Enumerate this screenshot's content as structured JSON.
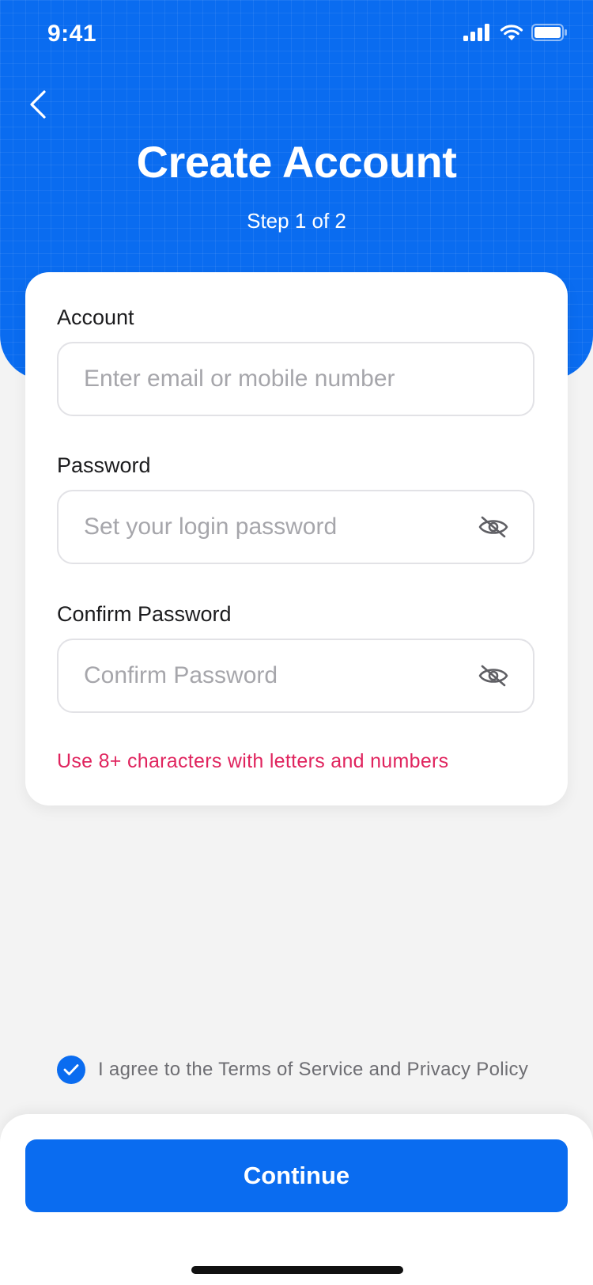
{
  "status_bar": {
    "time": "9:41"
  },
  "header": {
    "title": "Create Account",
    "step": "Step 1 of 2"
  },
  "form": {
    "account": {
      "label": "Account",
      "value": "",
      "placeholder": "Enter email or mobile number"
    },
    "password": {
      "label": "Password",
      "value": "",
      "placeholder": "Set your login password"
    },
    "confirm_password": {
      "label": "Confirm Password",
      "value": "",
      "placeholder": "Confirm Password"
    },
    "hint": "Use 8+ characters with letters and numbers"
  },
  "agreement": {
    "checked": true,
    "text": "I agree to the Terms of Service and Privacy Policy"
  },
  "footer": {
    "continue_label": "Continue"
  },
  "icons": {
    "back": "chevron-left-icon",
    "visibility": "eye-off-icon",
    "check": "check-icon",
    "signal": "signal-icon",
    "wifi": "wifi-icon",
    "battery": "battery-icon"
  },
  "colors": {
    "primary": "#0a6cf0",
    "hint": "#e0245e",
    "background": "#f3f3f3"
  }
}
